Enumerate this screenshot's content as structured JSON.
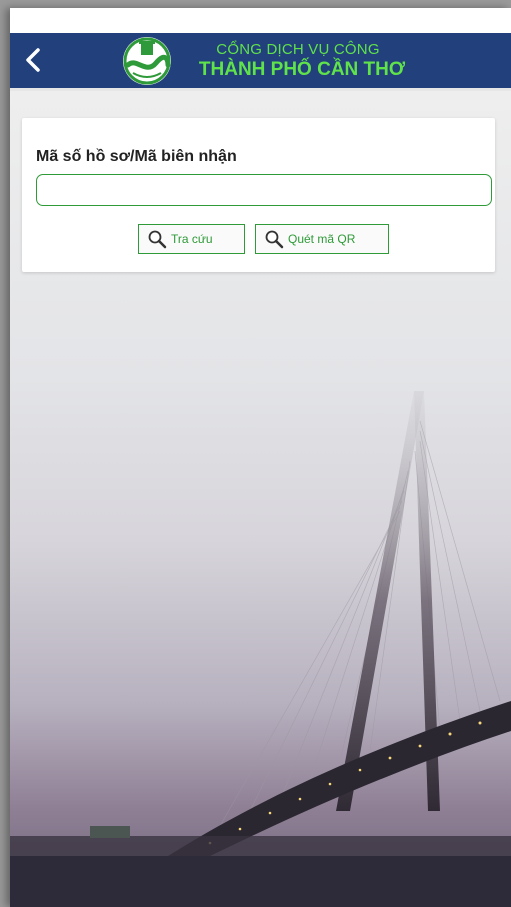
{
  "header": {
    "back_icon": "chevron-left-icon",
    "logo_icon": "can-tho-emblem-icon",
    "title_line1": "CỔNG DỊCH VỤ CÔNG",
    "title_line2": "THÀNH PHỐ CẦN THƠ"
  },
  "form": {
    "field_label": "Mã số hồ sơ/Mã biên nhận",
    "input_value": "",
    "input_placeholder": "",
    "search_button_label": "Tra cứu",
    "qr_button_label": "Quét mã QR",
    "button_icon": "magnifier-icon"
  },
  "colors": {
    "navbar_bg": "#22407c",
    "brand_green": "#5fe24a",
    "button_green": "#2e9a38"
  }
}
